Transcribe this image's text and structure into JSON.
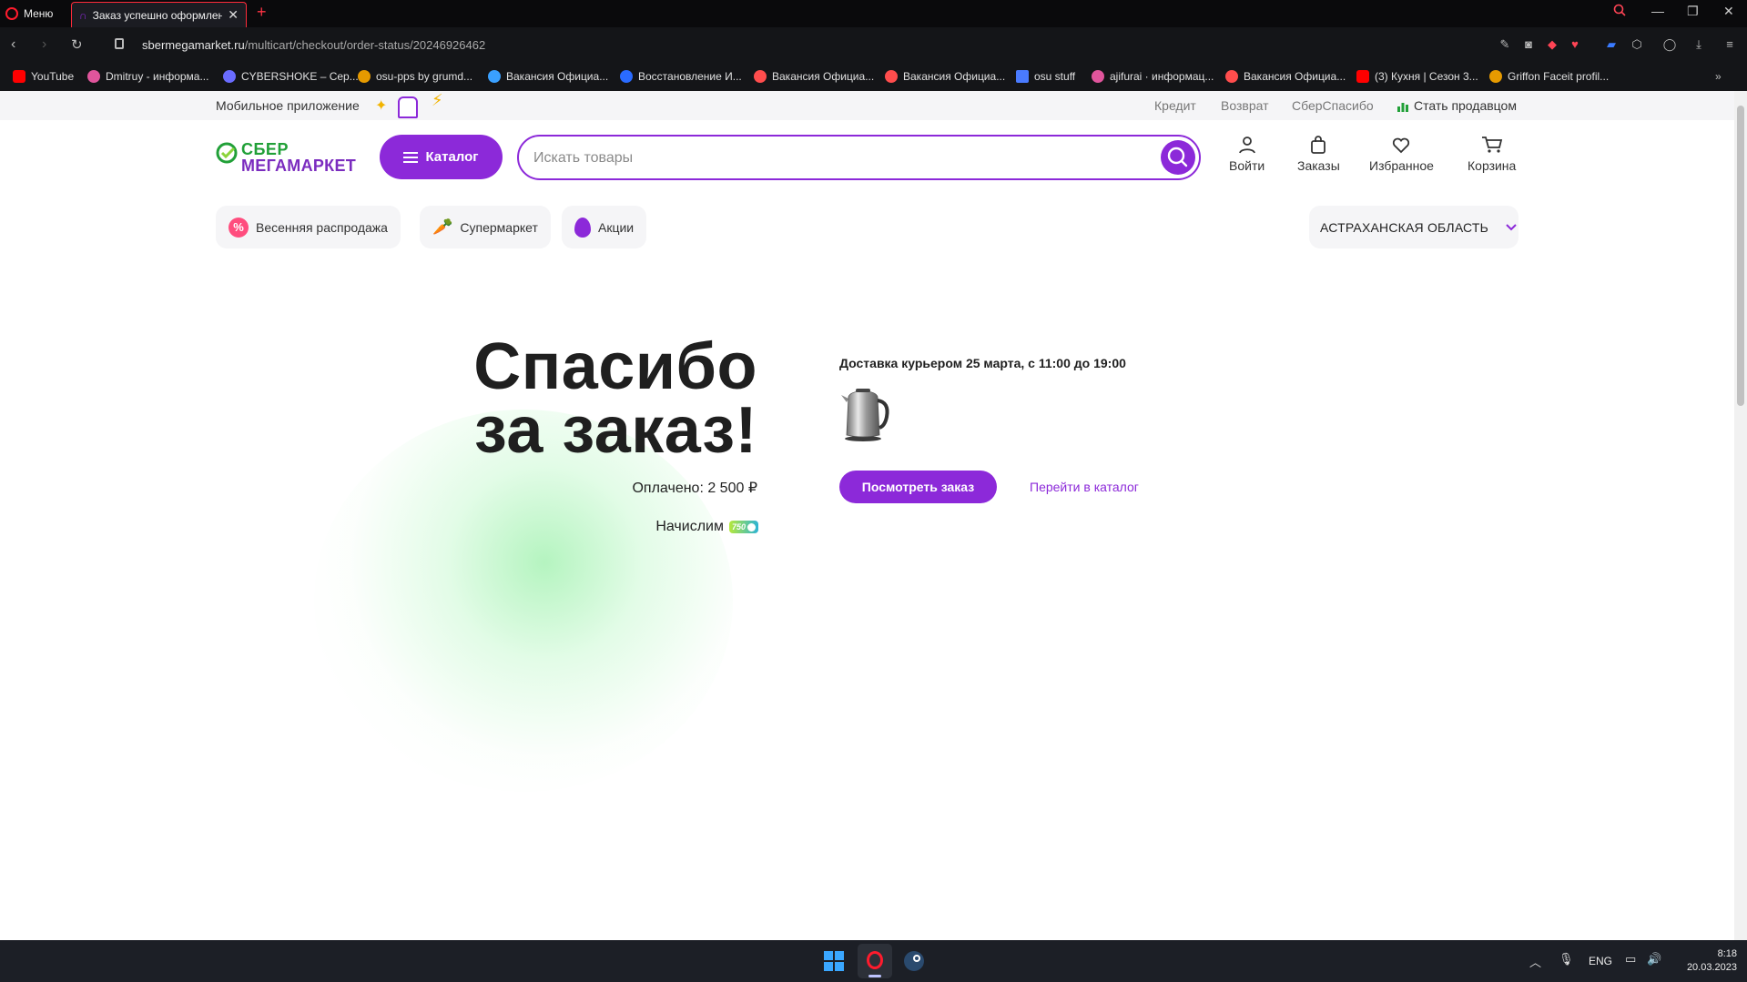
{
  "browser": {
    "menu_label": "Меню",
    "tab_title": "Заказ успешно оформлен",
    "url_host": "sbermegamarket.ru",
    "url_path": "/multicart/checkout/order-status/20246926462",
    "bookmarks": [
      {
        "label": "YouTube",
        "color": "#ff0000"
      },
      {
        "label": "Dmitruy - информа...",
        "color": "#e0559c"
      },
      {
        "label": "CYBERSHOKE – Сер...",
        "color": "#6a6cff"
      },
      {
        "label": "osu-pps by grumd...",
        "color": "#e69a00"
      },
      {
        "label": "Вакансия Официа...",
        "color": "#3aa0ff"
      },
      {
        "label": "Восстановление И...",
        "color": "#2a6bff"
      },
      {
        "label": "Вакансия Официа...",
        "color": "#ff4d4d"
      },
      {
        "label": "Вакансия Официа...",
        "color": "#ff4d4d"
      },
      {
        "label": "osu stuff",
        "color": "#4a7bff"
      },
      {
        "label": "ajifurai · информац...",
        "color": "#e0559c"
      },
      {
        "label": "Вакансия Официа...",
        "color": "#ff4d4d"
      },
      {
        "label": "(3) Кухня | Сезон 3...",
        "color": "#ff0000"
      },
      {
        "label": "Griffon Faceit profil...",
        "color": "#e69a00"
      }
    ]
  },
  "site": {
    "topstrip": {
      "mobile_app": "Мобильное приложение",
      "links": [
        "Кредит",
        "Возврат",
        "СберСпасибо"
      ],
      "seller": "Стать продавцом"
    },
    "logo": {
      "line1": "СБЕР",
      "line2": "МЕГАМАРКЕТ"
    },
    "catalog_label": "Каталог",
    "search_placeholder": "Искать товары",
    "header_actions": [
      "Войти",
      "Заказы",
      "Избранное",
      "Корзина"
    ],
    "pills": [
      "Весенняя распродажа",
      "Супермаркет",
      "Акции"
    ],
    "region": "АСТРАХАНСКАЯ ОБЛАСТЬ"
  },
  "order": {
    "thanks_line1": "Спасибо",
    "thanks_line2": "за заказ!",
    "paid": "Оплачено: 2 500 ₽",
    "bonus_label": "Начислим",
    "bonus_value": "750",
    "delivery": "Доставка курьером 25 марта, с 11:00 до 19:00",
    "view_order": "Посмотреть заказ",
    "go_catalog": "Перейти в каталог"
  },
  "colors": {
    "brand_purple": "#8c29d9",
    "brand_green": "#21a038"
  },
  "taskbar": {
    "lang": "ENG",
    "time": "8:18",
    "date": "20.03.2023"
  }
}
